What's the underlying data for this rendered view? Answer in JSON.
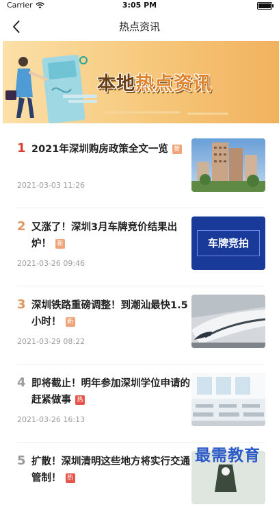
{
  "status": {
    "carrier": "Carrier",
    "time": "3:05 PM"
  },
  "nav": {
    "title": "热点资讯"
  },
  "banner": {
    "text_part1": "本地",
    "text_part2": "热点资讯"
  },
  "news": [
    {
      "rank": "1",
      "title": "2021年深圳购房政策全文一览",
      "badge": "新",
      "date": "2021-03-03 11:26"
    },
    {
      "rank": "2",
      "title": "又涨了！深圳3月车牌竞价结果出炉！",
      "badge": "新",
      "date": "2021-03-26 09:46",
      "thumb_text": "车牌竞拍"
    },
    {
      "rank": "3",
      "title": "深圳铁路重磅调整！到潮汕最快1.5小时！",
      "badge": "新",
      "date": "2021-03-29 08:22"
    },
    {
      "rank": "4",
      "title": "即将截止！明年参加深圳学位申请的赶紧做事",
      "badge": "热",
      "date": "2021-03-26 16:13"
    },
    {
      "rank": "5",
      "title": "扩散！深圳清明这些地方将实行交通管制！",
      "badge": "热",
      "date": ""
    }
  ],
  "watermark": "最需教育",
  "colors": {
    "rank_top": "#d93a2b",
    "rank_mid": "#e0945a",
    "rank_low": "#9a9a9a",
    "badge_new": "#f0a479",
    "badge_hot": "#e5554b"
  }
}
